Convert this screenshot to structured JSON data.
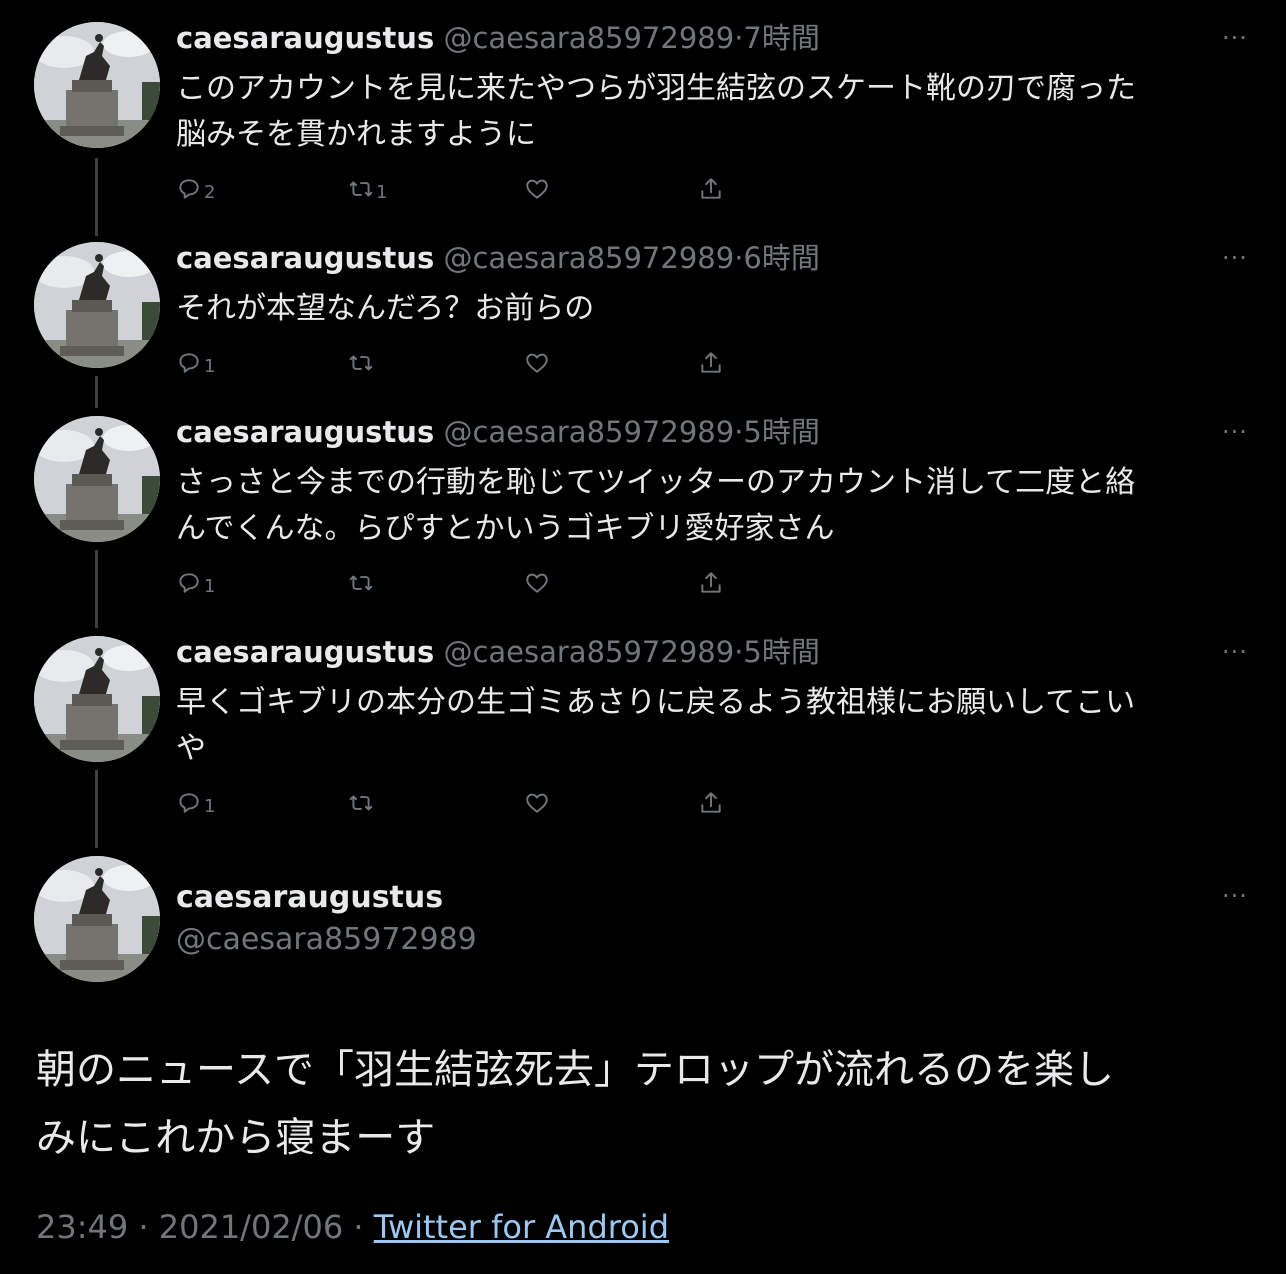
{
  "tweets": [
    {
      "name": "caesaraugustus",
      "handle": "@caesara85972989",
      "sep": "·",
      "time": "7時間",
      "text_lines": [
        "このアカウントを見に来たやつらが羽生結弦のスケート靴の刃で腐った",
        "脳みそを貫かれますように"
      ],
      "reply_count": "2",
      "retweet_count": "1",
      "more": "···"
    },
    {
      "name": "caesaraugustus",
      "handle": "@caesara85972989",
      "sep": "·",
      "time": "6時間",
      "text_lines": [
        "それが本望なんだろ？お前らの"
      ],
      "reply_count": "1",
      "retweet_count": "",
      "more": "···"
    },
    {
      "name": "caesaraugustus",
      "handle": "@caesara85972989",
      "sep": "·",
      "time": "5時間",
      "text_lines": [
        "さっさと今までの行動を恥じてツイッターのアカウント消して二度と絡",
        "んでくんな。らぴすとかいうゴキブリ愛好家さん"
      ],
      "reply_count": "1",
      "retweet_count": "",
      "more": "···"
    },
    {
      "name": "caesaraugustus",
      "handle": "@caesara85972989",
      "sep": "·",
      "time": "5時間",
      "text_lines": [
        "早くゴキブリの本分の生ゴミあさりに戻るよう教祖様にお願いしてこい",
        "や"
      ],
      "reply_count": "1",
      "retweet_count": "",
      "more": "···"
    }
  ],
  "main": {
    "name": "caesaraugustus",
    "handle": "@caesara85972989",
    "more": "···",
    "text_lines": [
      "朝のニュースで「羽生結弦死去」テロップが流れるのを楽し",
      "みにこれから寝まーす"
    ],
    "time": "23:49",
    "sep1": " · ",
    "date": "2021/02/06",
    "sep2": " · ",
    "source": "Twitter for Android"
  },
  "icons": [
    "reply-icon",
    "retweet-icon",
    "like-icon",
    "share-icon",
    "more-icon"
  ],
  "colors": {
    "background": "#000000",
    "text": "#e7e9ea",
    "muted": "#71767b",
    "link": "#9cc7f1"
  }
}
